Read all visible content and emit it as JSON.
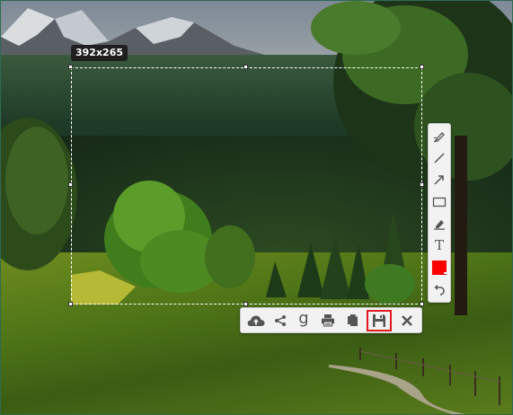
{
  "selection": {
    "size_label": "392x265"
  },
  "tool_panel": {
    "tools": [
      {
        "name": "pen-tool",
        "icon": "pen-icon"
      },
      {
        "name": "line-tool",
        "icon": "line-icon"
      },
      {
        "name": "arrow-tool",
        "icon": "arrow-icon"
      },
      {
        "name": "rectangle-tool",
        "icon": "rectangle-icon"
      },
      {
        "name": "marker-tool",
        "icon": "marker-icon"
      },
      {
        "name": "text-tool",
        "icon": "text-icon",
        "glyph": "T"
      },
      {
        "name": "color-picker",
        "icon": "color-swatch-icon"
      },
      {
        "name": "undo-tool",
        "icon": "undo-icon"
      }
    ],
    "current_color": "#ff0000"
  },
  "action_bar": {
    "actions": [
      {
        "name": "upload-button",
        "icon": "cloud-upload-icon"
      },
      {
        "name": "share-button",
        "icon": "share-icon"
      },
      {
        "name": "google-search-button",
        "icon": "google-icon",
        "glyph": "g"
      },
      {
        "name": "print-button",
        "icon": "printer-icon"
      },
      {
        "name": "copy-button",
        "icon": "copy-icon"
      },
      {
        "name": "save-button",
        "icon": "floppy-disk-icon",
        "active": true
      },
      {
        "name": "close-button",
        "icon": "close-icon"
      }
    ],
    "active_highlight_color": "#e11b1b"
  },
  "colors": {
    "toolbar_bg": "#f2f2f2",
    "icon_color": "#555555",
    "frame_border": "#2e6a53"
  }
}
